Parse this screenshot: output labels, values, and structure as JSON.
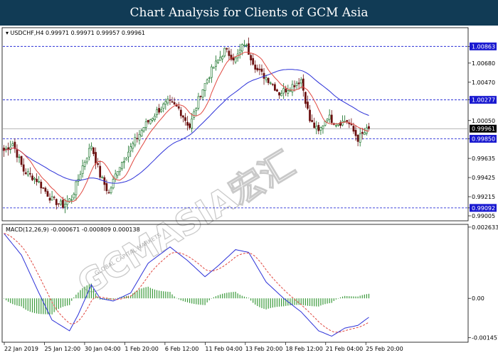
{
  "banner": {
    "title": "Chart Analysis for Clients of GCM Asia"
  },
  "watermark": {
    "brand": "GCMASIA宏汇",
    "tagline": "GLOBAL CAPITAL MARKETS"
  },
  "colors": {
    "banner_bg": "#113b55",
    "bull": "#0d6b1e",
    "bear": "#6b0f0f",
    "ma_fast": "#e0473f",
    "ma_slow": "#2b30d8",
    "macd_line": "#2b30d8",
    "signal_line": "#e0473f",
    "histogram": "#3c9a3c",
    "level_line": "#2b30d8",
    "level_tag": "#1a1ad0"
  },
  "chart_data": [
    {
      "type": "candlestick",
      "title": "USDCHF,H4",
      "ohlc_readout": [
        "0.99971",
        "0.99971",
        "0.99957",
        "0.99961"
      ],
      "ylim": [
        0.99005,
        1.01045
      ],
      "y_ticks": [
        "1.00863",
        "1.00680",
        "1.00470",
        "1.00277",
        "1.00050",
        "0.99850",
        "0.99635",
        "0.99425",
        "0.99215",
        "0.99092",
        "0.99005"
      ],
      "x_ticks": [
        "22 Jan 2019",
        "25 Jan 12:00",
        "30 Jan 04:00",
        "1 Feb 20:00",
        "6 Feb 12:00",
        "11 Feb 04:00",
        "13 Feb 20:00",
        "18 Feb 12:00",
        "21 Feb 04:00",
        "25 Feb 20:00"
      ],
      "levels": [
        {
          "value": 1.00863,
          "label": "1.00863"
        },
        {
          "value": 1.00277,
          "label": "1.00277"
        },
        {
          "value": 0.9985,
          "label": "0.99850"
        },
        {
          "value": 0.99092,
          "label": "0.99092"
        }
      ],
      "current_price": {
        "value": 0.99961,
        "label": "0.99961"
      },
      "anchors": [
        [
          0,
          0.9972
        ],
        [
          4,
          0.998
        ],
        [
          9,
          0.995
        ],
        [
          15,
          0.994
        ],
        [
          22,
          0.9918
        ],
        [
          27,
          0.9912
        ],
        [
          31,
          0.992
        ],
        [
          36,
          0.9955
        ],
        [
          40,
          0.9978
        ],
        [
          44,
          0.9945
        ],
        [
          48,
          0.9925
        ],
        [
          52,
          0.9952
        ],
        [
          58,
          0.9975
        ],
        [
          64,
          0.9998
        ],
        [
          70,
          1.0015
        ],
        [
          75,
          1.0025
        ],
        [
          80,
          1.0018
        ],
        [
          85,
          0.9998
        ],
        [
          90,
          1.0035
        ],
        [
          95,
          1.006
        ],
        [
          101,
          1.0082
        ],
        [
          106,
          1.0072
        ],
        [
          110,
          1.009
        ],
        [
          116,
          1.006
        ],
        [
          122,
          1.0048
        ],
        [
          126,
          1.0035
        ],
        [
          131,
          1.0042
        ],
        [
          136,
          1.005
        ],
        [
          140,
          1.0005
        ],
        [
          144,
          0.9992
        ],
        [
          148,
          1.001
        ],
        [
          152,
          1.0002
        ],
        [
          157,
          1.0005
        ],
        [
          162,
          0.9985
        ],
        [
          167,
          0.9996
        ]
      ],
      "ma_fast_period": 10,
      "ma_slow_period": 40
    },
    {
      "type": "macd",
      "title": "MACD(12,26,9) -0.000671 -0.000809 0.000138",
      "ylim": [
        -0.00157,
        0.00263
      ],
      "y_ticks": [
        "0.002633",
        "0.00",
        "-0.001457"
      ],
      "macd_anchors": [
        [
          0,
          0.0024
        ],
        [
          8,
          0.0016
        ],
        [
          16,
          0.0002
        ],
        [
          22,
          -0.0008
        ],
        [
          30,
          -0.0012
        ],
        [
          34,
          -0.0006
        ],
        [
          40,
          0.0005
        ],
        [
          44,
          0.0
        ],
        [
          50,
          -0.0001
        ],
        [
          58,
          0.0002
        ],
        [
          66,
          0.0013
        ],
        [
          76,
          0.0019
        ],
        [
          84,
          0.0014
        ],
        [
          92,
          0.0008
        ],
        [
          98,
          0.0012
        ],
        [
          106,
          0.0018
        ],
        [
          112,
          0.0017
        ],
        [
          120,
          0.0006
        ],
        [
          128,
          0.0
        ],
        [
          136,
          -0.0005
        ],
        [
          144,
          -0.0012
        ],
        [
          150,
          -0.0014
        ],
        [
          156,
          -0.0011
        ],
        [
          162,
          -0.001
        ],
        [
          167,
          -0.0007
        ]
      ],
      "signal_period": 9
    }
  ]
}
